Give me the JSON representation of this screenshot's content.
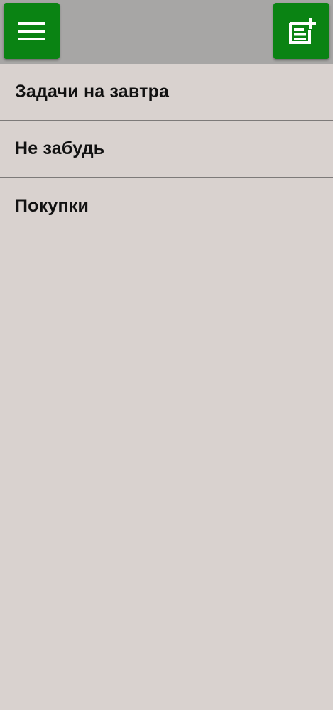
{
  "toolbar": {
    "menu_icon": "hamburger-menu-icon",
    "add_icon": "add-note-icon",
    "accent_color": "#0a8313",
    "bar_color": "#a7a6a5"
  },
  "lists": {
    "items": [
      {
        "label": "Задачи на завтра"
      },
      {
        "label": "Не забудь"
      },
      {
        "label": "Покупки"
      }
    ]
  },
  "background_color": "#d9d2cf"
}
